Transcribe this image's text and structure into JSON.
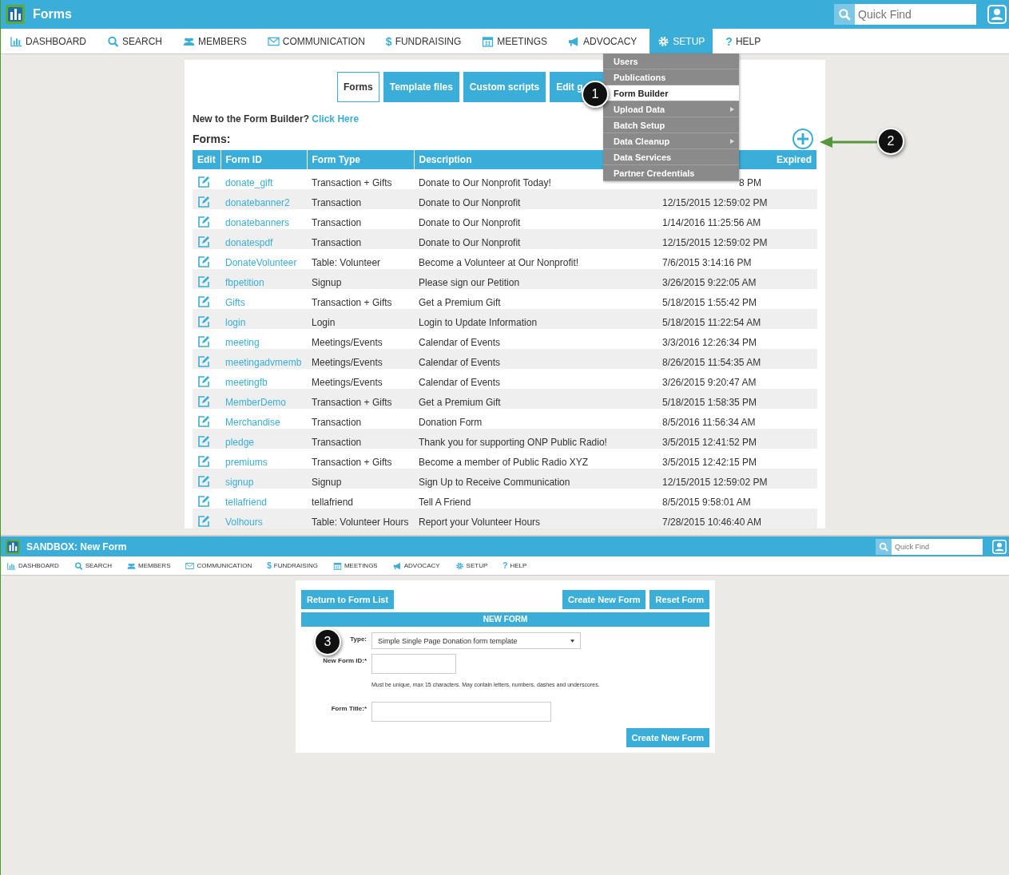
{
  "top": {
    "header": {
      "title": "Forms",
      "search_placeholder": "Quick Find"
    },
    "nav": [
      {
        "kind": "dashboard",
        "label": "DASHBOARD",
        "selected": false
      },
      {
        "kind": "search",
        "label": "SEARCH",
        "selected": false
      },
      {
        "kind": "members",
        "label": "MEMBERS",
        "selected": false
      },
      {
        "kind": "communication",
        "label": "COMMUNICATION",
        "selected": false
      },
      {
        "kind": "fundraising",
        "glyph": "$",
        "label": "FUNDRAISING",
        "selected": false
      },
      {
        "kind": "meetings",
        "label": "MEETINGS",
        "selected": false
      },
      {
        "kind": "advocacy",
        "label": "ADVOCACY",
        "selected": false
      },
      {
        "kind": "setup",
        "label": "SETUP",
        "selected": true
      },
      {
        "kind": "help",
        "glyph": "?",
        "label": "HELP",
        "selected": false
      }
    ],
    "tabs": [
      {
        "label": "Forms",
        "selected": true
      },
      {
        "label": "Template files",
        "selected": false
      },
      {
        "label": "Custom scripts",
        "selected": false
      },
      {
        "label": "Edit g",
        "selected": false
      }
    ],
    "intro": {
      "text": "New to the Form Builder?",
      "link": "Click Here"
    },
    "forms_heading": "Forms:",
    "table": {
      "columns": [
        "Edit",
        "Form ID",
        "Form Type",
        "Description",
        "",
        "Expired"
      ],
      "rows": [
        [
          "",
          "donate_gift",
          "Transaction + Gifts",
          "Donate to Our Nonprofit Today!",
          "8 PM"
        ],
        [
          "",
          "donatebanner2",
          "Transaction",
          "Donate to Our Nonprofit",
          "12/15/2015 12:59:02 PM"
        ],
        [
          "",
          "donatebanners",
          "Transaction",
          "Donate to Our Nonprofit",
          "1/14/2016 11:25:56 AM"
        ],
        [
          "",
          "donatespdf",
          "Transaction",
          "Donate to Our Nonprofit",
          "12/15/2015 12:59:02 PM"
        ],
        [
          "",
          "DonateVolunteer",
          "Table: Volunteer",
          "Become a Volunteer at Our Nonprofit!",
          "7/6/2015 3:14:16 PM"
        ],
        [
          "",
          "fbpetition",
          "Signup",
          "Please sign our Petition",
          "3/26/2015 9:22:05 AM"
        ],
        [
          "",
          "Gifts",
          "Transaction + Gifts",
          "Get a Premium Gift",
          "5/18/2015 1:55:42 PM"
        ],
        [
          "",
          "login",
          "Login",
          "Login to Update Information",
          "5/18/2015 11:22:54 AM"
        ],
        [
          "",
          "meeting",
          "Meetings/Events",
          "Calendar of Events",
          "3/3/2016 12:26:34 PM"
        ],
        [
          "",
          "meetingadvmemb",
          "Meetings/Events",
          "Calendar of Events",
          "8/26/2015 11:54:35 AM"
        ],
        [
          "",
          "meetingfb",
          "Meetings/Events",
          "Calendar of Events",
          "3/26/2015 9:20:47 AM"
        ],
        [
          "",
          "MemberDemo",
          "Transaction + Gifts",
          "Get a Premium Gift",
          "5/18/2015 1:58:35 PM"
        ],
        [
          "",
          "Merchandise",
          "Transaction",
          "Donation Form",
          "8/5/2016 11:56:34 AM"
        ],
        [
          "",
          "pledge",
          "Transaction",
          "Thank you for supporting ONP Public Radio!",
          "3/5/2015 12:41:52 PM"
        ],
        [
          "",
          "premiums",
          "Transaction + Gifts",
          "Become a member of Public Radio XYZ",
          "3/5/2015 12:42:15 PM"
        ],
        [
          "",
          "signup",
          "Signup",
          "Sign Up to Receive Communication",
          "12/15/2015 12:59:02 PM"
        ],
        [
          "",
          "tellafriend",
          "tellafriend",
          "Tell A Friend",
          "8/5/2015 9:58:01 AM"
        ],
        [
          "",
          "Volhours",
          "Table: Volunteer Hours",
          "Report your Volunteer Hours",
          "7/28/2015 10:46:40 AM"
        ]
      ]
    },
    "setup_menu": [
      {
        "label": "Users",
        "selected": false,
        "submenu": false
      },
      {
        "label": "Publications",
        "selected": false,
        "submenu": false
      },
      {
        "label": "Form Builder",
        "selected": true,
        "submenu": false
      },
      {
        "label": "Upload Data",
        "selected": false,
        "submenu": true
      },
      {
        "label": "Batch Setup",
        "selected": false,
        "submenu": false
      },
      {
        "label": "Data Cleanup",
        "selected": false,
        "submenu": true
      },
      {
        "label": "Data Services",
        "selected": false,
        "submenu": false
      },
      {
        "label": "Partner Credentials",
        "selected": false,
        "submenu": false
      }
    ],
    "callouts": [
      "1",
      "2"
    ]
  },
  "bottom": {
    "header": {
      "title": "SANDBOX: New Form",
      "search_placeholder": "Quick Find"
    },
    "nav": [
      {
        "kind": "dashboard",
        "label": "DASHBOARD",
        "selected": false
      },
      {
        "kind": "search",
        "label": "SEARCH",
        "selected": false
      },
      {
        "kind": "members",
        "label": "MEMBERS",
        "selected": false
      },
      {
        "kind": "communication",
        "label": "COMMUNICATION",
        "selected": false
      },
      {
        "kind": "fundraising",
        "glyph": "$",
        "label": "FUNDRAISING",
        "selected": false
      },
      {
        "kind": "meetings",
        "label": "MEETINGS",
        "selected": false
      },
      {
        "kind": "advocacy",
        "label": "ADVOCACY",
        "selected": false
      },
      {
        "kind": "setup",
        "label": "SETUP",
        "selected": false
      },
      {
        "kind": "help",
        "glyph": "?",
        "label": "HELP",
        "selected": false
      }
    ],
    "buttons_left": [
      "Return to Form List"
    ],
    "buttons_right": [
      "Create New Form",
      "Reset Form"
    ],
    "section_title": "NEW FORM",
    "type": {
      "label": "Type:",
      "value": "Simple Single Page Donation form template"
    },
    "form_id": {
      "label": "New Form ID:*",
      "hint": "Must be unique, max 15 characters. May contain letters, numbers, dashes and underscores."
    },
    "form_title": {
      "label": "Form Title:*"
    },
    "submit": "Create New Form",
    "callout": "3"
  }
}
